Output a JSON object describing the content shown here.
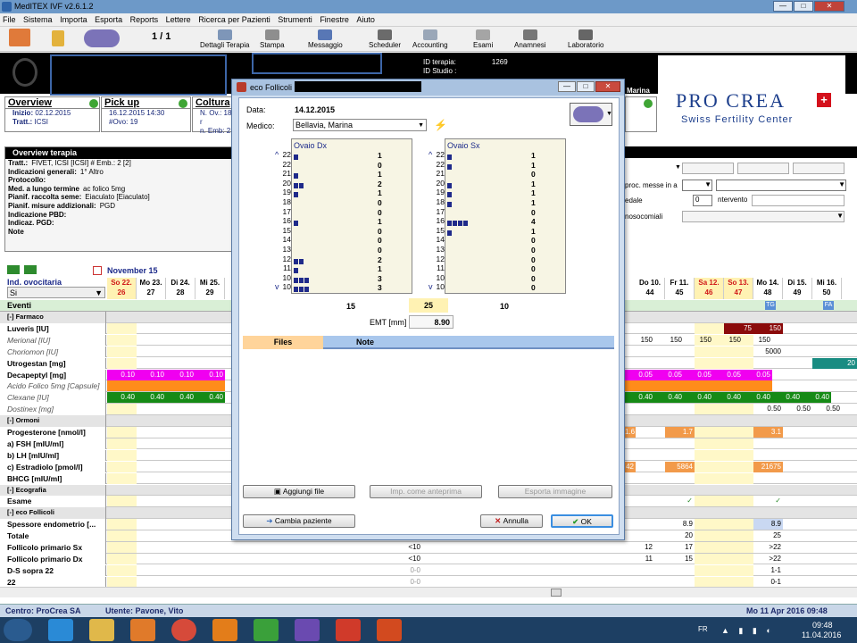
{
  "window": {
    "title": "MedITEX IVF v2.6.1.2"
  },
  "menu": [
    "File",
    "Sistema",
    "Importa",
    "Esporta",
    "Reports",
    "Lettere",
    "Ricerca per Pazienti",
    "Strumenti",
    "Finestre",
    "Aiuto"
  ],
  "toolbar": {
    "page": "1 / 1",
    "items": [
      "Dettagli Terapia",
      "Stampa",
      "Messaggio",
      "Scheduler",
      "Accounting",
      "Esami",
      "Anamnesi",
      "Laboratorio"
    ]
  },
  "patient": {
    "id_terapia_label": "ID terapia:",
    "id_terapia": "1269",
    "id_studio_label": "ID Studio :",
    "doctor_tail": "Marina"
  },
  "logo": {
    "line1": "PRO CREA",
    "line2": "Swiss Fertility Center"
  },
  "panels": {
    "overview": {
      "title": "Overview",
      "inizio_label": "Inizio:",
      "inizio": "02.12.2015",
      "tratt_label": "Tratt.:",
      "tratt": "ICSI"
    },
    "pickup": {
      "title": "Pick up",
      "date": "16.12.2015 14:30",
      "ovo": "#Ovo: 19"
    },
    "coltura": {
      "title": "Coltura",
      "novo": "N. Ov.: 18 r",
      "nemb": "n. Emb: 2"
    }
  },
  "overview_terapia": {
    "title": "Overview terapia",
    "rows": [
      {
        "k": "Tratt.:",
        "v": "FIVET, ICSI     [ICSI]    # Emb.: 2    [2]"
      },
      {
        "k": "Indicazioni generali:",
        "v": "1° Altro"
      },
      {
        "k": "Protocollo:",
        "v": ""
      },
      {
        "k": "Med. a lungo termine",
        "v": "ac folico 5mg"
      },
      {
        "k": "Pianif. raccolta seme:",
        "v": "Eiaculato     [Eiaculato]"
      },
      {
        "k": "Pianif. misure addizionali:",
        "v": "PGD"
      },
      {
        "k": "Indicazione PBD:",
        "v": ""
      },
      {
        "k": "Indicaz. PGD:",
        "v": ""
      },
      {
        "k": "Note",
        "v": ""
      }
    ]
  },
  "right_form": {
    "item1": "proc. messe in a",
    "item2": "edale",
    "item3": "nosocomiali",
    "value": "0",
    "intervento": "ntervento"
  },
  "calendar": {
    "month": "November 15",
    "ind_label": "Ind. ovocitaria",
    "ind_value": "Si",
    "days_left": [
      {
        "d": "So 22.",
        "n": "26",
        "we": true
      },
      {
        "d": "Mo 23.",
        "n": "27"
      },
      {
        "d": "Di 24.",
        "n": "28"
      },
      {
        "d": "Mi 25.",
        "n": "29"
      }
    ],
    "days_right": [
      {
        "d": "Do 10.",
        "n": "44"
      },
      {
        "d": "Fr 11.",
        "n": "45"
      },
      {
        "d": "Sa 12.",
        "n": "46",
        "we": true
      },
      {
        "d": "So 13.",
        "n": "47",
        "we": true
      },
      {
        "d": "Mo 14.",
        "n": "48"
      },
      {
        "d": "Di 15.",
        "n": "49"
      },
      {
        "d": "Mi 16.",
        "n": "50"
      }
    ],
    "eventi": "Eventi",
    "tags": [
      "TG",
      "FA"
    ]
  },
  "grid_rows": [
    {
      "label": "[-] Farmaco",
      "type": "section"
    },
    {
      "label": "Luveris [IU]",
      "type": "bold"
    },
    {
      "label": "Merional [IU]",
      "type": "ital"
    },
    {
      "label": "Choriomon [IU]",
      "type": "ital"
    },
    {
      "label": "Utrogestan [mg]",
      "type": "bold"
    },
    {
      "label": "Decapeptyl [mg]",
      "type": "bold"
    },
    {
      "label": "Acido Folico 5mg [Capsule]",
      "type": "ital"
    },
    {
      "label": "Clexane [IU]",
      "type": "ital"
    },
    {
      "label": "Dostinex [mg]",
      "type": "ital"
    },
    {
      "label": "[-] Ormoni",
      "type": "section"
    },
    {
      "label": "Progesterone  [nmol/l]",
      "type": "bold"
    },
    {
      "label": "a) FSH  [mIU/ml]",
      "type": "bold"
    },
    {
      "label": "b) LH  [mIU/ml]",
      "type": "bold"
    },
    {
      "label": "c) Estradiolo  [pmol/l]",
      "type": "bold"
    },
    {
      "label": "BHCG  [mIU/ml]",
      "type": "bold"
    },
    {
      "label": "[-] Ecografia",
      "type": "section"
    },
    {
      "label": "Esame",
      "type": "bold"
    },
    {
      "label": "[-] eco Follicoli",
      "type": "section"
    },
    {
      "label": "Spessore endometrio [...",
      "type": "bold"
    },
    {
      "label": "Totale",
      "type": "bold"
    },
    {
      "label": "Follicolo primario Sx",
      "type": "bold"
    },
    {
      "label": "Follicolo primario Dx",
      "type": "bold"
    },
    {
      "label": "D-S sopra 22",
      "type": "bold"
    },
    {
      "label": "22",
      "type": "bold"
    }
  ],
  "grid_values": {
    "decapeptyl": "0.10",
    "decapeptyl_r": "0.05",
    "clexane": "0.40",
    "merional": "150",
    "luveris": "75",
    "luveris2": "150",
    "choriomon": "5000",
    "dostinex": "0.50",
    "utrogestan": "20",
    "progest1": "1.6",
    "progest2": "1.7",
    "progest3": "3.1",
    "estra1": "42",
    "estra2": "5864",
    "estra3": "21675",
    "check": "✓",
    "spessore1": "8.9",
    "spessore2": "8.9",
    "totale1": "20",
    "totale2": "25",
    "fsx0": "<10",
    "fsx1": "12",
    "fsx2": "17",
    "fsx3": ">22",
    "fdx0": "<10",
    "fdx1": "11",
    "fdx2": "15",
    "fdx3": ">22",
    "ds0": "0-0",
    "ds3": "1-1",
    "r22_0": "0-0",
    "r22_3": "0-1"
  },
  "dialog": {
    "title": "eco Follicoli",
    "data_label": "Data:",
    "data": "14.12.2015",
    "medico_label": "Medico:",
    "medico": "Bellavia, Marina",
    "ovaio_dx_title": "Ovaio Dx",
    "ovaio_sx_title": "Ovaio Sx",
    "sizes": [
      "22",
      "22",
      "21",
      "20",
      "19",
      "18",
      "17",
      "16",
      "15",
      "14",
      "13",
      "12",
      "11",
      "10",
      "10"
    ],
    "dx_counts": [
      1,
      0,
      1,
      2,
      1,
      0,
      0,
      1,
      0,
      0,
      0,
      2,
      1,
      3,
      3
    ],
    "sx_counts": [
      1,
      1,
      0,
      1,
      1,
      1,
      0,
      4,
      1,
      0,
      0,
      0,
      0,
      0,
      0
    ],
    "total_dx": "15",
    "total_all": "25",
    "total_sx": "10",
    "emt_label": "EMT [mm]",
    "emt": "8.90",
    "tabs": [
      "Files",
      "Note"
    ],
    "buttons": {
      "aggiungi": "Aggiungi file",
      "anteprima": "Imp. come anteprima",
      "esporta": "Esporta immagine",
      "cambia": "Cambia paziente",
      "annulla": "Annulla",
      "ok": "OK"
    }
  },
  "status": {
    "centro": "Centro: ProCrea SA",
    "utente": "Utente: Pavone, Vito",
    "date": "Mo 11 Apr 2016 09:48"
  },
  "taskbar": {
    "lang": "FR",
    "time": "09:48",
    "date": "11.04.2016"
  },
  "colors": {
    "magenta": "#f000f0",
    "orange": "#ff8c1a",
    "green": "#168a16",
    "darkred": "#8b0b0b",
    "teal": "#198c82",
    "yellow": "#fff8c8"
  }
}
